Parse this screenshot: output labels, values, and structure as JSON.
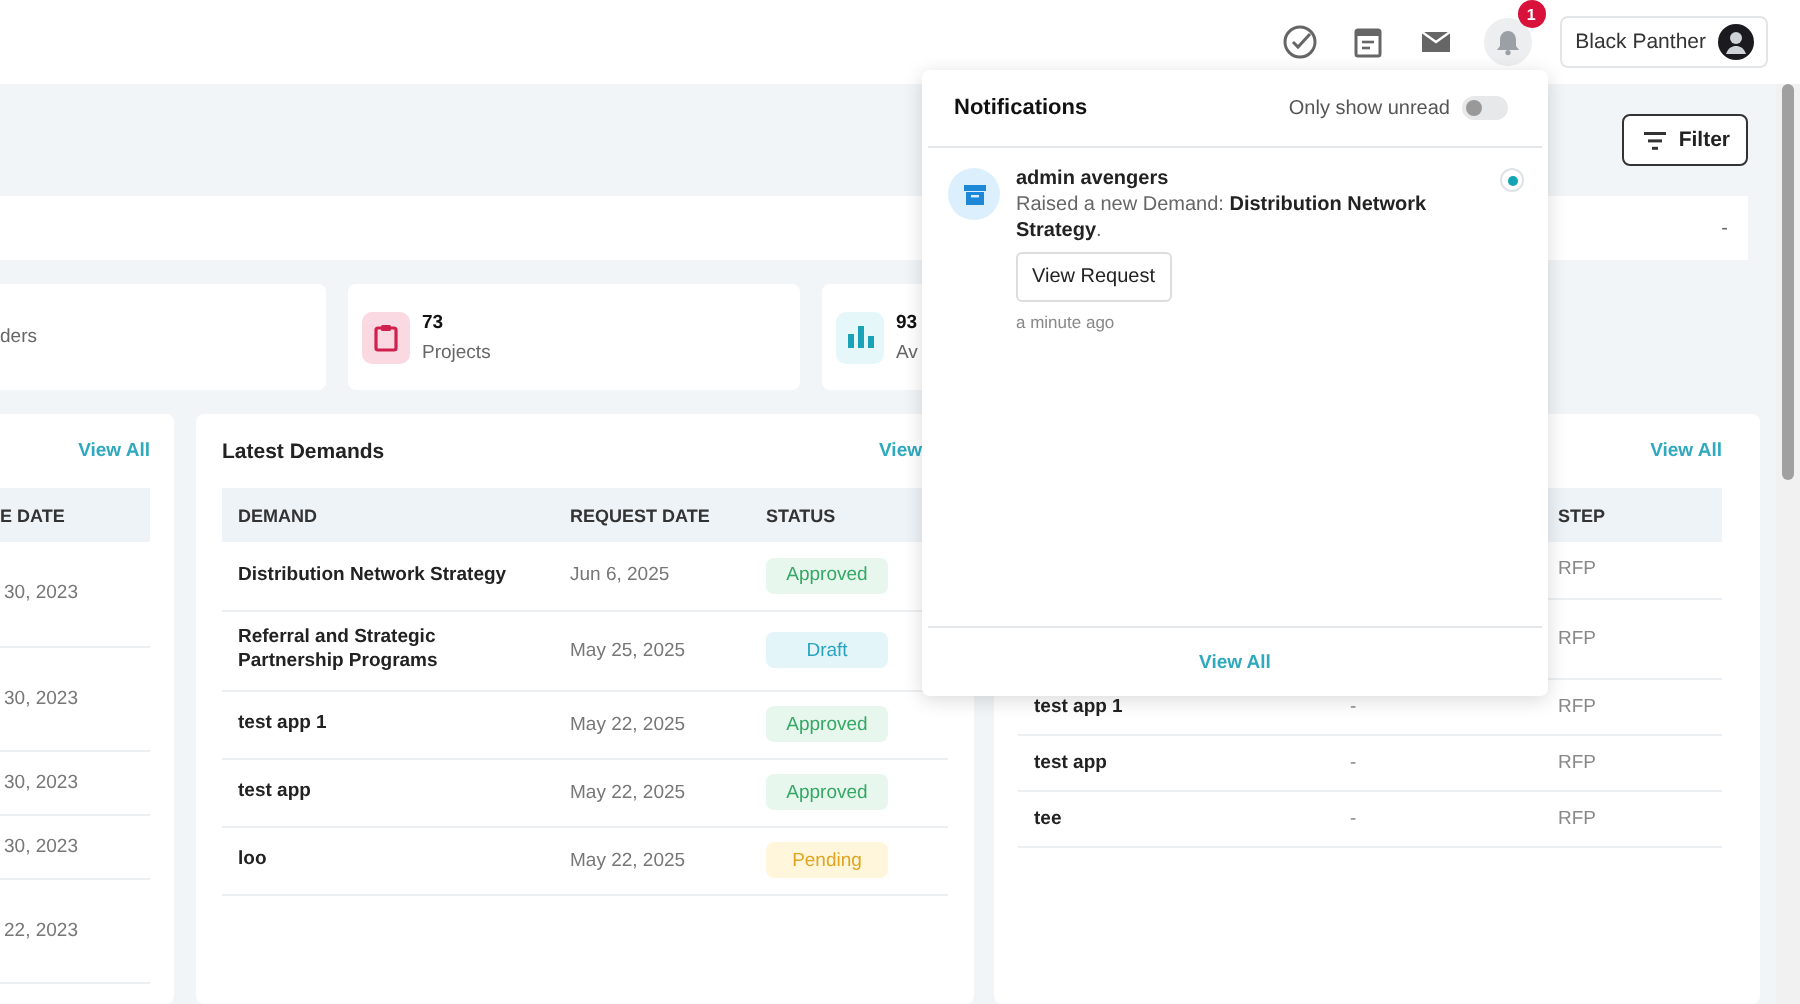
{
  "top_bar": {
    "notification_count": "1",
    "user": {
      "name": "Black Panther"
    }
  },
  "page_header": {
    "filter_button": "Filter"
  },
  "info_strip": {
    "value": "-"
  },
  "stat_cards": [
    {
      "kind": "partial",
      "label": "ders"
    },
    {
      "kind": "projects",
      "value": "73",
      "label": "Projects"
    },
    {
      "kind": "chart",
      "value": "93",
      "label": "Av"
    }
  ],
  "left_card": {
    "link": "View All",
    "columns": [
      "E DATE"
    ],
    "rows": [
      "30, 2023",
      "30, 2023",
      "30, 2023",
      "30, 2023",
      "22, 2023"
    ]
  },
  "demands_card": {
    "title": "Latest Demands",
    "link": "View",
    "columns": [
      "DEMAND",
      "REQUEST DATE",
      "STATUS"
    ],
    "rows": [
      {
        "demand": "Distribution Network Strategy",
        "date": "Jun 6, 2025",
        "status": "Approved",
        "kind": "approved"
      },
      {
        "demand": "Referral and Strategic Partnership Programs",
        "date": "May 25, 2025",
        "status": "Draft",
        "kind": "draft"
      },
      {
        "demand": "test app 1",
        "date": "May 22, 2025",
        "status": "Approved",
        "kind": "approved"
      },
      {
        "demand": "test app",
        "date": "May 22, 2025",
        "status": "Approved",
        "kind": "approved"
      },
      {
        "demand": "loo",
        "date": "May 22, 2025",
        "status": "Pending",
        "kind": "pending"
      }
    ]
  },
  "right_card": {
    "link": "View All",
    "columns": [
      "STEP"
    ],
    "rows": [
      {
        "step": "RFP"
      },
      {
        "step": "RFP"
      },
      {
        "name": "test app 1",
        "column_2": "-",
        "step": "RFP"
      },
      {
        "name": "test app",
        "column_2": "-",
        "step": "RFP"
      },
      {
        "name": "tee",
        "column_2": "-",
        "step": "RFP"
      }
    ]
  },
  "notifications": {
    "title": "Notifications",
    "filter_label": "Only show unread",
    "only_unread": false,
    "items": [
      {
        "sender": "admin avengers",
        "message": "Raised a new Demand: **Distribution Network Strategy**.",
        "action": "View Request",
        "time": "a minute ago",
        "unread": true
      }
    ],
    "view_all": "View All"
  }
}
